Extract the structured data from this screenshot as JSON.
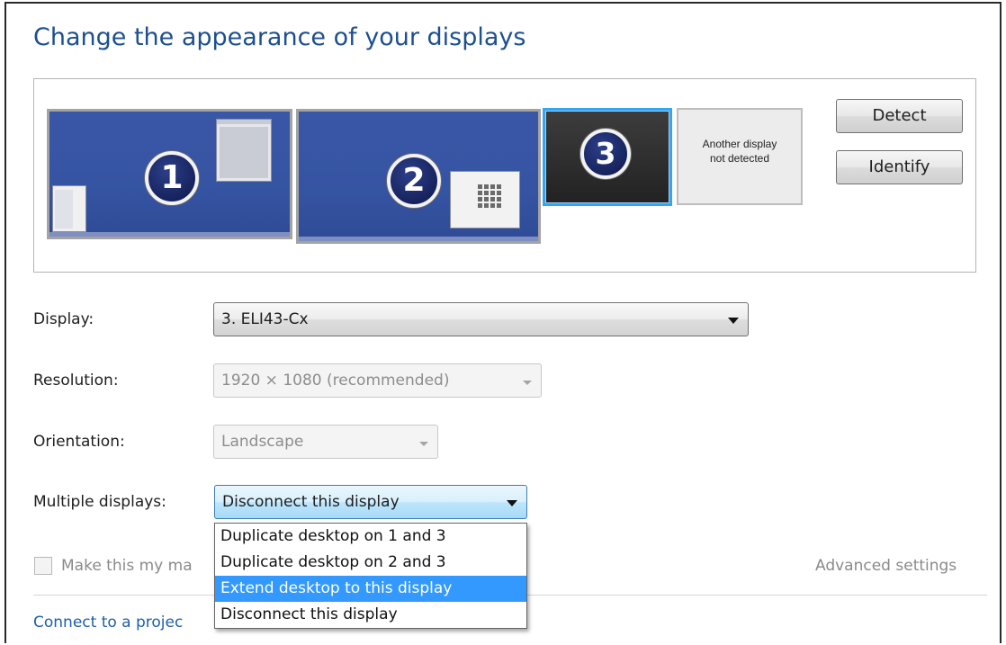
{
  "title": "Change the appearance of your displays",
  "preview": {
    "monitors": [
      {
        "number": "1"
      },
      {
        "number": "2"
      },
      {
        "number": "3",
        "selected": true
      }
    ],
    "not_detected": {
      "line1": "Another display",
      "line2": "not detected"
    }
  },
  "buttons": {
    "detect": "Detect",
    "identify": "Identify"
  },
  "fields": {
    "display": {
      "label": "Display:",
      "value": "3. ELI43-Cx"
    },
    "resolution": {
      "label": "Resolution:",
      "value": "1920 × 1080 (recommended)",
      "disabled": true
    },
    "orientation": {
      "label": "Orientation:",
      "value": "Landscape",
      "disabled": true
    },
    "multiple": {
      "label": "Multiple displays:",
      "value": "Disconnect this display"
    }
  },
  "multiple_options": [
    "Duplicate desktop on 1 and 3",
    "Duplicate desktop on 2 and 3",
    "Extend desktop to this display",
    "Disconnect this display"
  ],
  "highlighted_option": "Extend desktop to this display",
  "main_display_checkbox": {
    "label": "Make this my ma",
    "checked": false
  },
  "advanced_settings": "Advanced settings",
  "projector_link": "Connect to a projec",
  "colors": {
    "title": "#1d4f91",
    "highlight": "#3399ff",
    "link": "#1e5fad"
  }
}
